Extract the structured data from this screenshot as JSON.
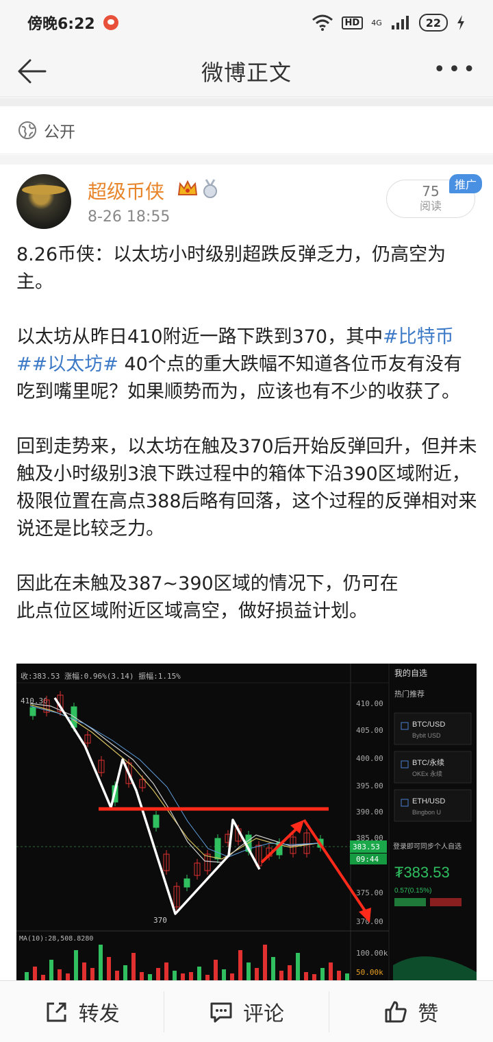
{
  "status_bar": {
    "time": "傍晚6:22",
    "hd": "HD",
    "network": "4G",
    "battery": "22"
  },
  "header": {
    "title": "微博正文"
  },
  "visibility": {
    "label": "公开"
  },
  "author": {
    "name": "超级币侠",
    "time": "8-26 18:55",
    "reads_count": "75",
    "reads_label": "阅读",
    "promo_badge": "推广"
  },
  "post": {
    "p1": "8.26币侠：以太坊小时级别超跌反弹乏力，仍高空为主。",
    "p2_before": "以太坊从昨日410附近一路下跌到370，其中",
    "tag1": "#比特币#",
    "tag2": "#以太坊#",
    "p2_after": " 40个点的重大跌幅不知道各位币友有没有吃到嘴里呢？如果顺势而为，应该也有不少的收获了。",
    "p3": "回到走势来，以太坊在触及370后开始反弹回升，但并未触及小时级别3浪下跌过程中的箱体下沿390区域附近，极限位置在高点388后略有回落，这个过程的反弹相对来说还是比较乏力。",
    "p4_line1": "因此在未触及387~390区域的情况下，仍可在",
    "p4_line2": "此点位区域附近区域高空，做好损益计划。"
  },
  "chart": {
    "top_readout": "收:383.53  涨幅:0.96%(3.14)  振幅:1.15%",
    "high_label": "410.36",
    "low_label": "370",
    "price_ticks": [
      "410.00",
      "405.00",
      "400.00",
      "395.00",
      "390.00",
      "385.00",
      "375.00",
      "370.00"
    ],
    "current_price_box": "383.53",
    "time_box": "09:44",
    "volume_readout": "MA(10):28,508.8280",
    "volume_ticks": [
      "100.00k",
      "50.00k"
    ],
    "side_title": "我的自选",
    "side_hot": "热门推荐",
    "watch_items": [
      {
        "symbol": "BTC/USD",
        "sub": "Bybit USD"
      },
      {
        "symbol": "BTC/永续",
        "sub": "OKEx 永续"
      },
      {
        "symbol": "ETH/USD",
        "sub": "Bingbon U"
      }
    ],
    "side_note": "登录即可同步个人自选",
    "side_price": "₮383.53",
    "side_change": "0.57(0.15%)",
    "accent_red": "#ff2a1a",
    "up_color": "#e03030",
    "down_color": "#30c060"
  },
  "actions": {
    "repost": "转发",
    "comment": "评论",
    "like": "赞"
  }
}
